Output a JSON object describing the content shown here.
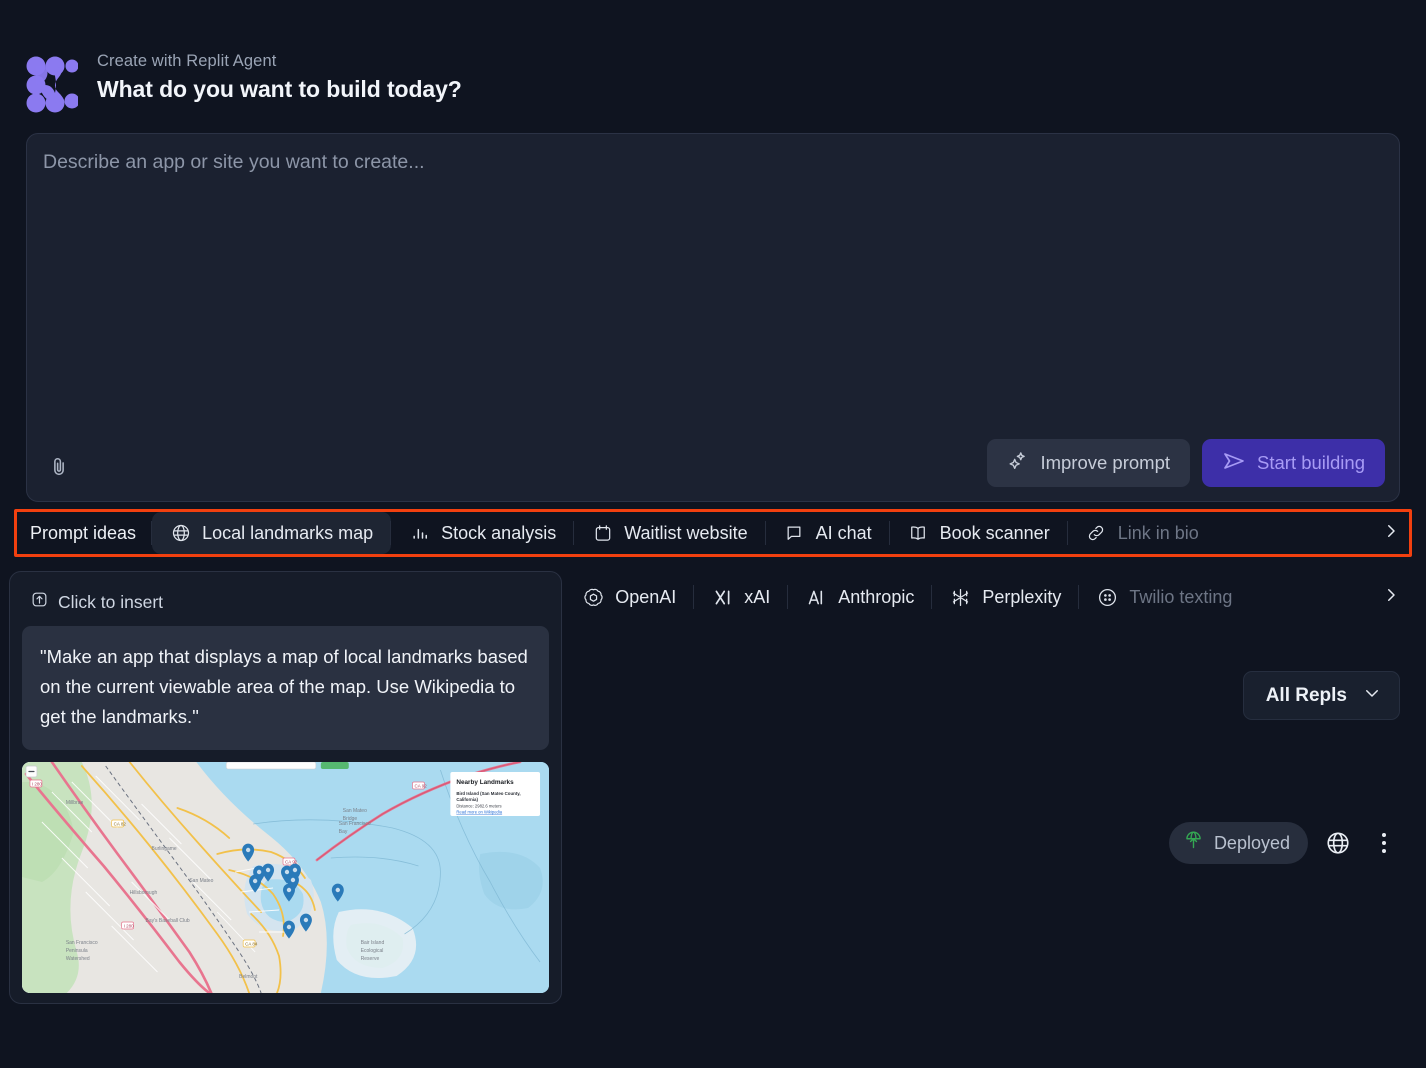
{
  "header": {
    "eyebrow": "Create with Replit Agent",
    "headline": "What do you want to build today?",
    "logo_icon": "replit-logo-icon",
    "brand_color": "#8b7af0"
  },
  "composer": {
    "placeholder": "Describe an app or site you want to create...",
    "value": "",
    "attach_icon": "paperclip-icon",
    "improve_label": "Improve prompt",
    "improve_icon": "sparkles-icon",
    "start_label": "Start building",
    "start_icon": "send-icon",
    "start_bg": "#3d2fa8",
    "start_fg": "#a79bf5"
  },
  "prompt_ideas": {
    "highlight_color": "#f2400f",
    "label": "Prompt ideas",
    "next_icon": "chevron-right-icon",
    "items": [
      {
        "label": "Local landmarks map",
        "icon": "globe-icon",
        "selected": true,
        "faded": false
      },
      {
        "label": "Stock analysis",
        "icon": "bar-chart-icon",
        "selected": false,
        "faded": false
      },
      {
        "label": "Waitlist website",
        "icon": "calendar-icon",
        "selected": false,
        "faded": false
      },
      {
        "label": "AI chat",
        "icon": "chat-bubble-icon",
        "selected": false,
        "faded": false
      },
      {
        "label": "Book scanner",
        "icon": "book-icon",
        "selected": false,
        "faded": false
      },
      {
        "label": "Link in bio",
        "icon": "link-icon",
        "selected": false,
        "faded": true
      }
    ]
  },
  "integrations": {
    "next_icon": "chevron-right-icon",
    "items": [
      {
        "label": "OpenAI",
        "icon": "openai-icon",
        "faded": false
      },
      {
        "label": "xAI",
        "icon": "xai-icon",
        "faded": false
      },
      {
        "label": "Anthropic",
        "icon": "anthropic-icon",
        "faded": false
      },
      {
        "label": "Perplexity",
        "icon": "perplexity-icon",
        "faded": false
      },
      {
        "label": "Twilio texting",
        "icon": "twilio-icon",
        "faded": true
      }
    ]
  },
  "popup": {
    "insert_label": "Click to insert",
    "insert_icon": "insert-up-icon",
    "prompt_text": "\"Make an app that displays a map of local landmarks based on the current viewable area of the map. Use Wikipedia to get the landmarks.\"",
    "preview": {
      "name": "map-preview-thumbnail",
      "panel_title": "Nearby Landmarks",
      "panel_place": "Bird Island (San Mateo County, California)",
      "panel_distance": "Distance: 2982.6 meters",
      "panel_link": "Read more on Wikipedia",
      "zoom_out_label": "−"
    }
  },
  "repls": {
    "filter_label": "All Repls",
    "filter_icon": "chevron-down-icon",
    "status_label": "Deployed",
    "status_icon": "deploy-rocket-icon",
    "status_color": "#34a853",
    "globe_icon": "globe-icon",
    "menu_icon": "kebab-menu-icon"
  }
}
